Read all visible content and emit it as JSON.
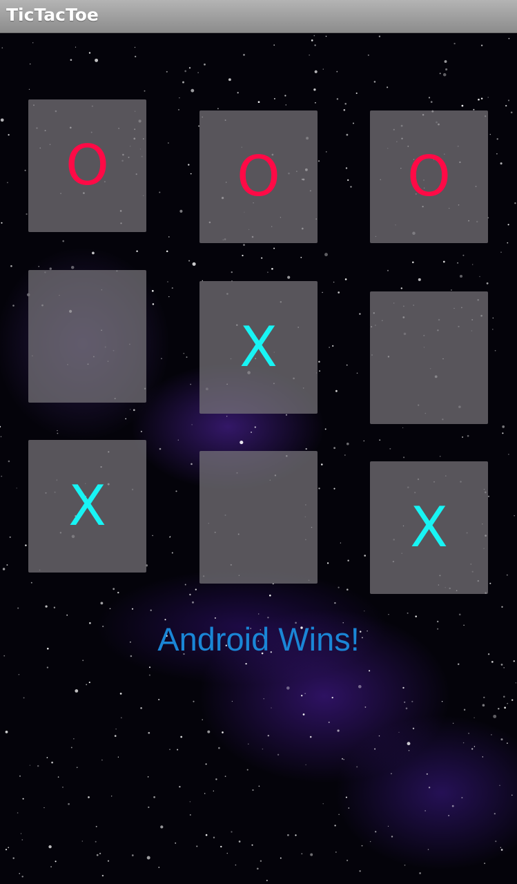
{
  "app": {
    "title": "TicTacToe"
  },
  "board": {
    "cells": [
      {
        "id": "r1c1",
        "value": "O"
      },
      {
        "id": "r1c2",
        "value": "O"
      },
      {
        "id": "r1c3",
        "value": "O"
      },
      {
        "id": "r2c1",
        "value": ""
      },
      {
        "id": "r2c2",
        "value": "X"
      },
      {
        "id": "r2c3",
        "value": ""
      },
      {
        "id": "r3c1",
        "value": "X"
      },
      {
        "id": "r3c2",
        "value": ""
      },
      {
        "id": "r3c3",
        "value": "X"
      }
    ]
  },
  "status": {
    "message": "Android Wins!"
  },
  "colors": {
    "o_mark": "#ff0a46",
    "x_mark": "#18f4f4",
    "status_text": "#1a86d6",
    "cell_background": "#78767c"
  }
}
